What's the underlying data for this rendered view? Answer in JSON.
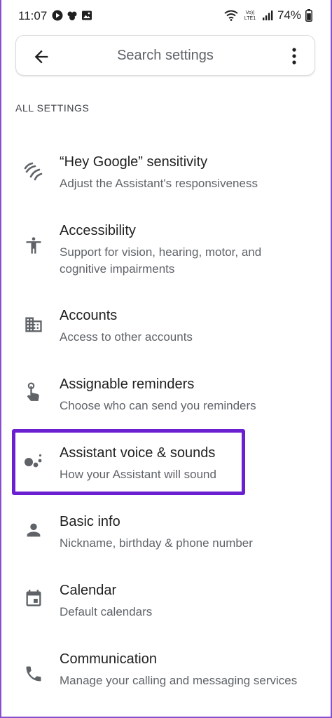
{
  "status_bar": {
    "time": "11:07",
    "network_label": "Vo)) LTE1",
    "battery": "74%"
  },
  "search": {
    "placeholder": "Search settings"
  },
  "section_header": "ALL SETTINGS",
  "items": [
    {
      "title": "“Hey Google” sensitivity",
      "subtitle": "Adjust the Assistant's responsiveness",
      "icon": "sensitivity-icon"
    },
    {
      "title": "Accessibility",
      "subtitle": "Support for vision, hearing, motor, and cognitive impairments",
      "icon": "accessibility-icon"
    },
    {
      "title": "Accounts",
      "subtitle": "Access to other accounts",
      "icon": "building-icon"
    },
    {
      "title": "Assignable reminders",
      "subtitle": "Choose who can send you reminders",
      "icon": "touch-hand-icon"
    },
    {
      "title": "Assistant voice & sounds",
      "subtitle": "How your Assistant will sound",
      "icon": "assistant-dots-icon"
    },
    {
      "title": "Basic info",
      "subtitle": "Nickname, birthday & phone number",
      "icon": "person-icon"
    },
    {
      "title": "Calendar",
      "subtitle": "Default calendars",
      "icon": "calendar-icon"
    },
    {
      "title": "Communication",
      "subtitle": "Manage your calling and messaging services",
      "icon": "phone-icon"
    }
  ],
  "colors": {
    "highlight": "#6a1fd1",
    "frame": "#8a4fd0",
    "text_primary": "#1f1f1f",
    "text_secondary": "#5f6368",
    "icon": "#5f6368"
  }
}
